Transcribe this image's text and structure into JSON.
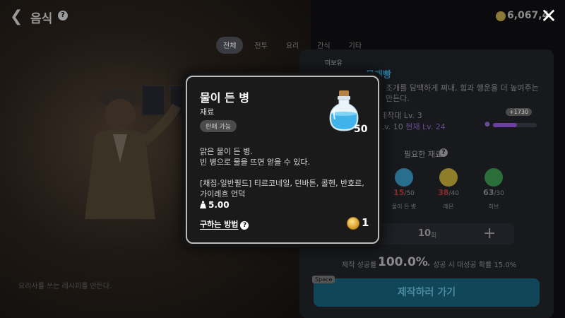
{
  "header": {
    "title": "음식",
    "back_icon": "chevron-left-icon",
    "help_icon": "help-circle-icon",
    "gold_amount": "6,067,4",
    "close_icon": "close-icon"
  },
  "tabs": [
    {
      "label": "전체",
      "active": true
    },
    {
      "label": "전투",
      "active": false
    },
    {
      "label": "요리",
      "active": false
    },
    {
      "label": "간식",
      "active": false
    },
    {
      "label": "기타",
      "active": false
    }
  ],
  "recipe_panel": {
    "tag": "미보유",
    "name": "물개빵",
    "description": "조개를 담백하게 쪄내, 힘과 행운을 더 높여주는 만든다.",
    "requirement_1": "제작대 Lv. 3",
    "requirement_2_base": "Lv. 10",
    "requirement_2_current": "현재 Lv. 24",
    "level_badge": "+1730",
    "level_progress": 0.55,
    "materials_title": "필요한 재료",
    "materials": [
      {
        "name": "물이 든 병",
        "have": "15",
        "need": "/50",
        "color": "#4aa8d8"
      },
      {
        "name": "레몬",
        "have": "38",
        "need": "/40",
        "color": "#d8c23a"
      },
      {
        "name": "허브",
        "have": "63",
        "need": "/30",
        "color": "#3e9e52"
      }
    ],
    "quantity": "10",
    "quantity_unit": "회",
    "success_label": "제작 성공률",
    "success_rate": "100.0%",
    "bonus_text": "• 성공 시 대성공 확률 15.0%",
    "space_key": "Space",
    "craft_button": "제작하러 가기"
  },
  "background_hint": "요리사를 쓰는 레시피를 만든다.",
  "popup": {
    "name": "물이 든 병",
    "type": "재료",
    "badge": "판매 가능",
    "count": "50",
    "description": "맑은 물이 든 병.\n빈 병으로 물을 뜨면 얻을 수 있다.",
    "locations": "[채집-일반필드] 티르코네일, 던바튼, 콜헨, 반호르,\n가이레흐 언덕",
    "weight": "5.00",
    "how_to_get": "구하는 방법",
    "price": "1",
    "item_icon": "water-bottle-icon",
    "weight_icon": "weight-icon",
    "coin_icon": "gold-coin-icon"
  }
}
